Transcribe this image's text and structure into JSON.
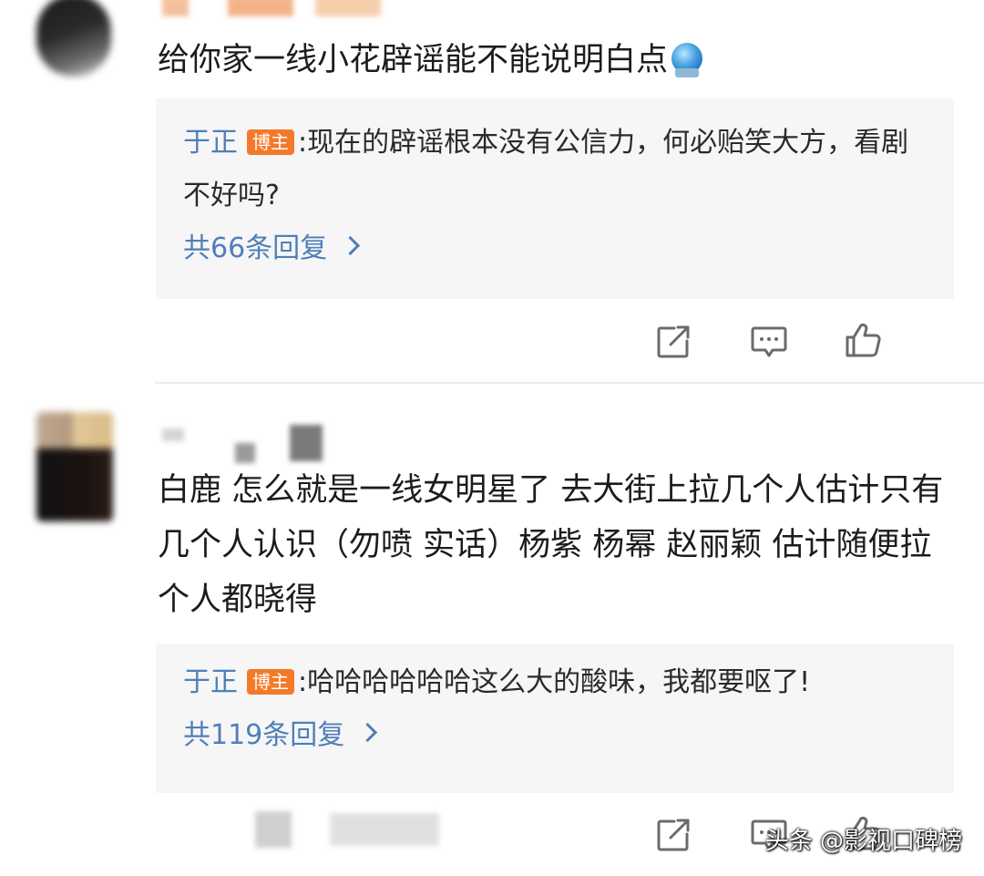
{
  "comments": [
    {
      "text": "给你家一线小花辟谣能不能说明白点",
      "reply": {
        "author": "于正",
        "badge": "博主",
        "separator": ":",
        "text": "现在的辟谣根本没有公信力，何必贻笑大方，看剧不好吗?",
        "count_label": "共66条回复"
      }
    },
    {
      "text": "白鹿 怎么就是一线女明星了 去大街上拉几个人估计只有几个人认识（勿喷 实话）杨紫 杨幂 赵丽颖 估计随便拉个人都晓得",
      "reply": {
        "author": "于正",
        "badge": "博主",
        "separator": ":",
        "text": "哈哈哈哈哈哈这么大的酸味，我都要呕了!",
        "count_label": "共119条回复"
      }
    }
  ],
  "icons": {
    "share": "share-icon",
    "comment": "comment-icon",
    "like": "like-icon",
    "emoji": "globe-emoji-icon"
  },
  "colors": {
    "reply_link": "#4f7fb8",
    "badge": "#f47a2a",
    "reply_bg": "#f6f6f6"
  },
  "watermark": "头条 @影视口碑榜"
}
